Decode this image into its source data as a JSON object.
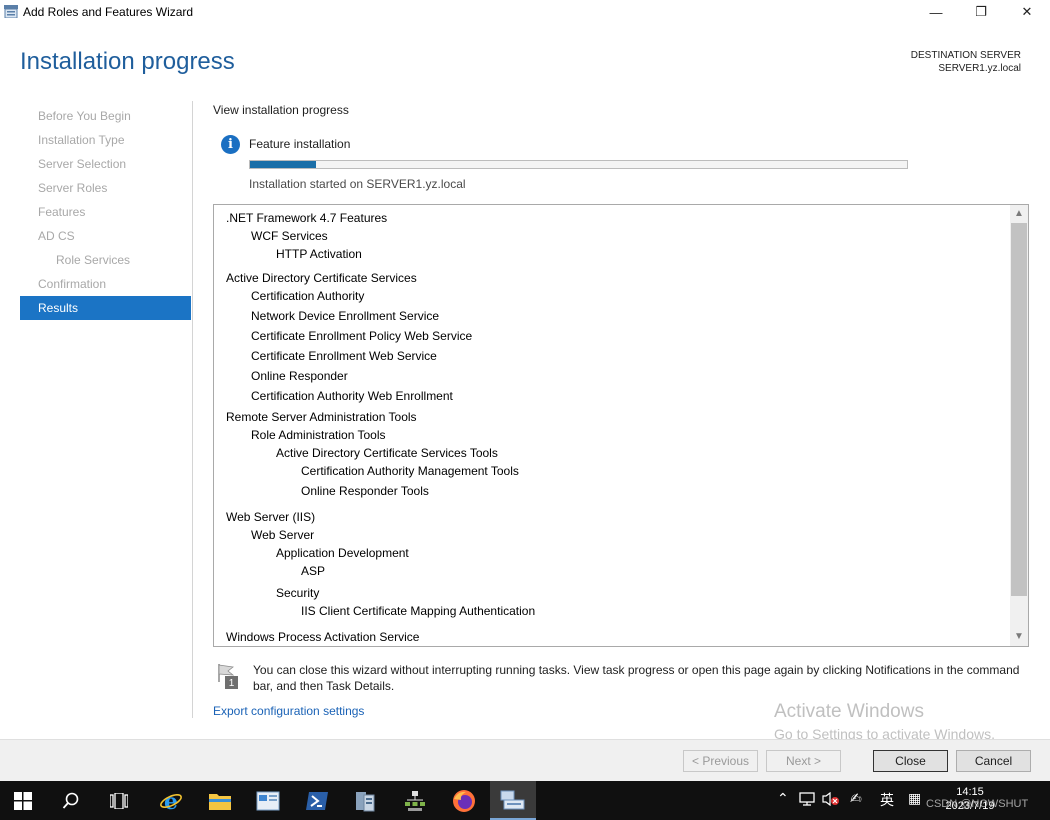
{
  "window": {
    "title": "Add Roles and Features Wizard",
    "controls": {
      "minimize": "—",
      "restore": "❐",
      "close": "✕"
    }
  },
  "header": {
    "page_title": "Installation progress",
    "destination_label": "DESTINATION SERVER",
    "destination_server": "SERVER1.yz.local"
  },
  "nav": {
    "items": [
      {
        "label": "Before You Begin"
      },
      {
        "label": "Installation Type"
      },
      {
        "label": "Server Selection"
      },
      {
        "label": "Server Roles"
      },
      {
        "label": "Features"
      },
      {
        "label": "AD CS"
      },
      {
        "label": "Role Services"
      },
      {
        "label": "Confirmation"
      },
      {
        "label": "Results"
      }
    ],
    "active": "Results"
  },
  "main": {
    "view_label": "View installation progress",
    "feature_label": "Feature installation",
    "progress_percent": 10,
    "started_text": "Installation started on SERVER1.yz.local",
    "features": [
      {
        "label": ".NET Framework 4.7 Features",
        "level": 0
      },
      {
        "label": "WCF Services",
        "level": 1
      },
      {
        "label": "HTTP Activation",
        "level": 2
      },
      {
        "label": "Active Directory Certificate Services",
        "level": 0
      },
      {
        "label": "Certification Authority",
        "level": 1
      },
      {
        "label": "Network Device Enrollment Service",
        "level": 1
      },
      {
        "label": "Certificate Enrollment Policy Web Service",
        "level": 1
      },
      {
        "label": "Certificate Enrollment Web Service",
        "level": 1
      },
      {
        "label": "Online Responder",
        "level": 1
      },
      {
        "label": "Certification Authority Web Enrollment",
        "level": 1
      },
      {
        "label": "Remote Server Administration Tools",
        "level": 0
      },
      {
        "label": "Role Administration Tools",
        "level": 1
      },
      {
        "label": "Active Directory Certificate Services Tools",
        "level": 2
      },
      {
        "label": "Certification Authority Management Tools",
        "level": 3
      },
      {
        "label": "Online Responder Tools",
        "level": 3
      },
      {
        "label": "Web Server (IIS)",
        "level": 0
      },
      {
        "label": "Web Server",
        "level": 1
      },
      {
        "label": "Application Development",
        "level": 2
      },
      {
        "label": "ASP",
        "level": 3
      },
      {
        "label": "Security",
        "level": 2
      },
      {
        "label": "IIS Client Certificate Mapping Authentication",
        "level": 3
      },
      {
        "label": "Windows Process Activation Service",
        "level": 0
      }
    ],
    "notice_text": "You can close this wizard without interrupting running tasks. View task progress or open this page again by clicking Notifications in the command bar, and then Task Details.",
    "notice_badge": "1",
    "export_link": "Export configuration settings"
  },
  "watermark": {
    "line1": "Activate Windows",
    "line2": "Go to Settings to activate Windows."
  },
  "buttons": {
    "previous": "< Previous",
    "next": "Next >",
    "close": "Close",
    "cancel": "Cancel"
  },
  "taskbar": {
    "ime": "英",
    "time": "14:15",
    "date": "2023/7/19",
    "overlay_text": "CSDN @NOWSHUT"
  },
  "colors": {
    "accent": "#1b74c5",
    "title_blue": "#1f5e9c",
    "progress_fill": "#1b6fa8"
  }
}
